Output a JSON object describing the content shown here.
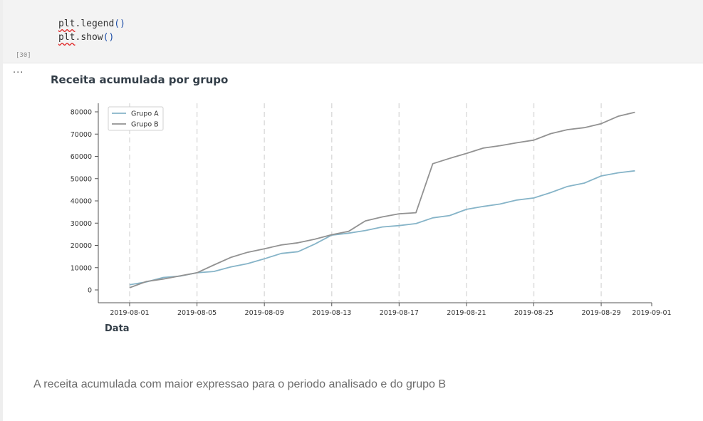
{
  "notebook": {
    "code_cell": {
      "execution_count": "[30]",
      "lines": [
        {
          "obj": "plt",
          "fn": "legend",
          "args": "()"
        },
        {
          "obj": "plt",
          "fn": "show",
          "args": "()"
        }
      ]
    },
    "output_toggle": "···",
    "markdown_text": "A receita acumulada com maior expressao para o periodo analisado e do grupo B"
  },
  "colors": {
    "series_a": "#86b4c8",
    "series_b": "#929292",
    "title": "#333e48",
    "grid": "#dddddd"
  },
  "chart_data": {
    "type": "line",
    "title": "Receita acumulada por grupo",
    "xlabel": "Data",
    "ylabel": "",
    "x_ticks": [
      "2019-08-01",
      "2019-08-05",
      "2019-08-09",
      "2019-08-13",
      "2019-08-17",
      "2019-08-21",
      "2019-08-25",
      "2019-08-29",
      "2019-09-01"
    ],
    "y_ticks": [
      "0",
      "10000",
      "20000",
      "30000",
      "40000",
      "50000",
      "60000",
      "70000",
      "80000"
    ],
    "xlim": [
      "2019-08-01",
      "2019-09-01"
    ],
    "ylim": [
      0,
      80000
    ],
    "grid": "vertical dashed",
    "legend": "top-left",
    "x": [
      "2019-08-01",
      "2019-08-02",
      "2019-08-03",
      "2019-08-04",
      "2019-08-05",
      "2019-08-06",
      "2019-08-07",
      "2019-08-08",
      "2019-08-09",
      "2019-08-10",
      "2019-08-11",
      "2019-08-12",
      "2019-08-13",
      "2019-08-14",
      "2019-08-15",
      "2019-08-16",
      "2019-08-17",
      "2019-08-18",
      "2019-08-19",
      "2019-08-20",
      "2019-08-21",
      "2019-08-22",
      "2019-08-23",
      "2019-08-24",
      "2019-08-25",
      "2019-08-26",
      "2019-08-27",
      "2019-08-28",
      "2019-08-29",
      "2019-08-30",
      "2019-08-31"
    ],
    "series": [
      {
        "name": "Grupo A",
        "color_key": "series_a",
        "values": [
          2300,
          3600,
          5600,
          6200,
          7700,
          8300,
          10300,
          11800,
          14000,
          16400,
          17200,
          20600,
          24600,
          25500,
          26700,
          28300,
          28900,
          29800,
          32400,
          33400,
          36200,
          37500,
          38600,
          40400,
          41300,
          43700,
          46500,
          48000,
          51200,
          52600,
          53500
        ]
      },
      {
        "name": "Grupo B",
        "color_key": "series_b",
        "values": [
          1000,
          3800,
          4900,
          6300,
          7700,
          11200,
          14600,
          16900,
          18500,
          20200,
          21200,
          22800,
          24800,
          26300,
          31000,
          32800,
          34200,
          34700,
          56700,
          59100,
          61300,
          63700,
          64800,
          66100,
          67300,
          70200,
          72000,
          72900,
          74700,
          78000,
          79800
        ]
      }
    ]
  }
}
